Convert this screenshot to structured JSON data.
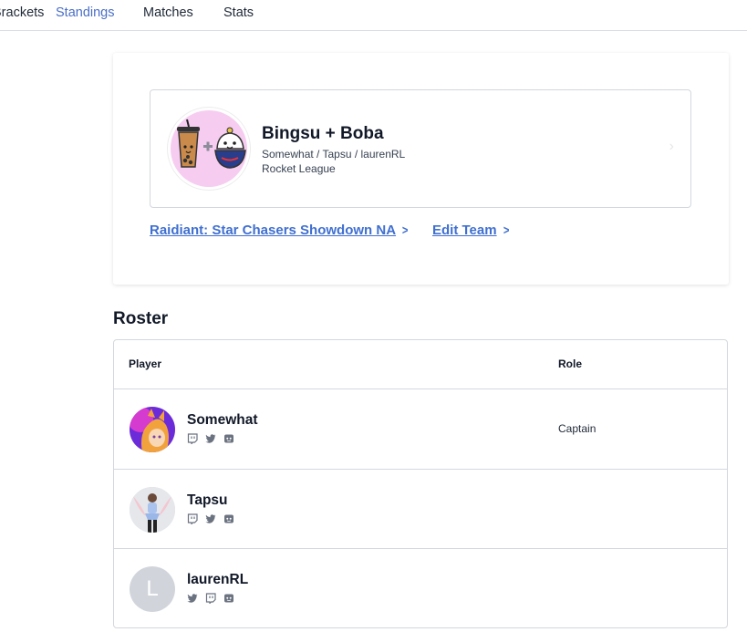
{
  "nav": {
    "tabs": [
      {
        "label": "Brackets"
      },
      {
        "label": "Standings",
        "active": true
      },
      {
        "label": "Matches"
      },
      {
        "label": "Stats"
      }
    ],
    "active_color": "#4a6fc7"
  },
  "team": {
    "name": "Bingsu + Boba",
    "players": "Somewhat / Tapsu / laurenRL",
    "game": "Rocket League",
    "logo_icon": "bingsu-boba-logo",
    "logo_bg_color": "#f6cdf0"
  },
  "links": {
    "tournament": "Raidiant: Star Chasers Showdown NA",
    "edit_team": "Edit Team",
    "color": "#3f6fd0"
  },
  "roster": {
    "title": "Roster",
    "headers": {
      "player": "Player",
      "role": "Role"
    },
    "rows": [
      {
        "name": "Somewhat",
        "role": "Captain",
        "socials": [
          "twitch-icon",
          "twitter-icon",
          "discord-icon"
        ]
      },
      {
        "name": "Tapsu",
        "role": "",
        "socials": [
          "twitch-icon",
          "twitter-icon",
          "discord-icon"
        ]
      },
      {
        "name": "laurenRL",
        "role": "",
        "avatar_letter": "L",
        "socials": [
          "twitter-icon",
          "twitch-icon",
          "discord-icon"
        ]
      }
    ]
  }
}
